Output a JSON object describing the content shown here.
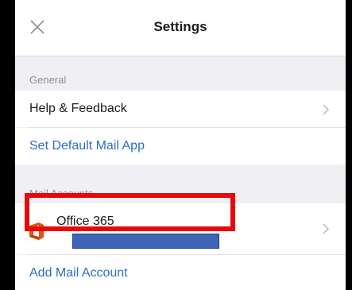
{
  "nav": {
    "title": "Settings",
    "close_icon": "close-icon"
  },
  "general": {
    "header": "General",
    "items": [
      {
        "label": "Help & Feedback",
        "icon": "chevron-right-icon"
      },
      {
        "label": "Set Default Mail App"
      }
    ]
  },
  "mail_accounts": {
    "header": "Mail Accounts",
    "account": {
      "name": "Office 365",
      "icon": "office-365-icon",
      "chevron_icon": "chevron-right-icon"
    },
    "add_label": "Add Mail Account"
  },
  "colors": {
    "link": "#2b6fc6",
    "highlight": "#e8070a",
    "redacted_bar": "#3f64b8"
  }
}
